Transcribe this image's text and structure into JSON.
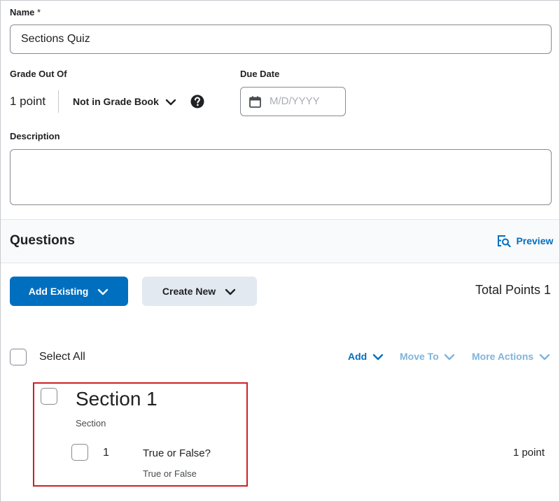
{
  "form": {
    "name_label": "Name",
    "required_mark": "*",
    "name_value": "Sections Quiz",
    "grade_label": "Grade Out Of",
    "grade_value": "1 point",
    "grade_book_value": "Not in Grade Book",
    "due_date_label": "Due Date",
    "due_date_placeholder": "M/D/YYYY",
    "description_label": "Description",
    "description_value": ""
  },
  "questions": {
    "heading": "Questions",
    "preview_label": "Preview",
    "add_existing_label": "Add Existing",
    "create_new_label": "Create New",
    "total_points": "Total Points 1",
    "select_all_label": "Select All",
    "add_label": "Add",
    "move_to_label": "Move To",
    "more_actions_label": "More Actions",
    "section": {
      "title": "Section 1",
      "type": "Section",
      "question": {
        "number": "1",
        "title": "True or False?",
        "type": "True or False",
        "points": "1 point"
      }
    }
  },
  "colors": {
    "primary": "#006fbf",
    "secondary_button": "#e3e9f1",
    "highlight_border": "#cd2026",
    "band": "#f9fafb"
  },
  "icons": [
    "question-help-icon",
    "calendar-icon",
    "preview-icon",
    "chevron-down-icon"
  ]
}
